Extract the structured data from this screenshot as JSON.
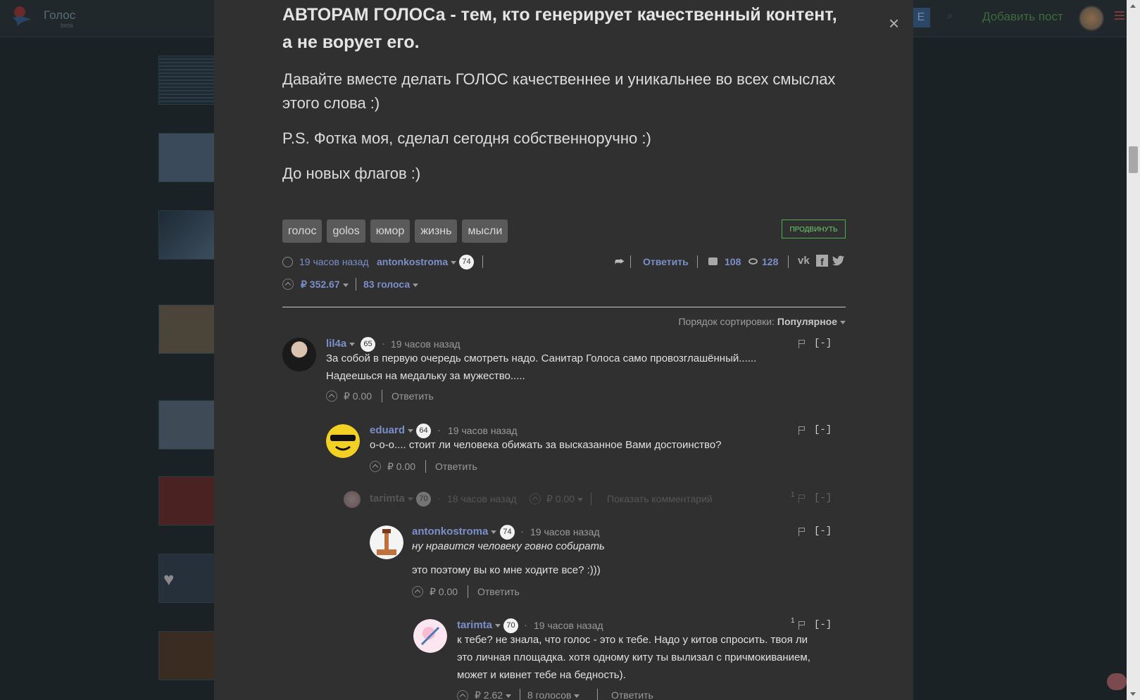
{
  "site": {
    "logo_text": "Голос",
    "logo_sub": "beta",
    "header_button": "E",
    "add_post": "Добавить пост"
  },
  "modal": {
    "close": "×",
    "heading": "АВТОРАМ ГОЛОСа - тем, кто генерирует качественный контент, а не ворует его.",
    "paragraph1": "Давайте вместе делать ГОЛОС качественнее и уникальнее во всех смыслах этого слова :)",
    "paragraph2": "P.S. Фотка моя, сделал сегодня собственноручно :)",
    "paragraph3": "До новых флагов :)",
    "tags": [
      "голос",
      "golos",
      "юмор",
      "жизнь",
      "мысли"
    ],
    "promote_button": "ПРОДВИНУТЬ",
    "meta": {
      "time": "19 часов назад",
      "author": "antonkostroma",
      "reputation": "74",
      "reply": "Ответить",
      "comments_count": "108",
      "views_count": "128",
      "vk": "vk",
      "facebook": "f",
      "payout": "₽ 352.67",
      "votes": "83 голоса"
    },
    "sort": {
      "label": "Порядок сортировки:",
      "value": "Популярное"
    }
  },
  "comments": [
    {
      "author": "lil4a",
      "reputation": "65",
      "time": "19 часов назад",
      "text_lines": [
        "За собой в первую очередь смотреть надо. Санитар Голоса само провозглашённый......",
        "Надеешься на медальку за мужество....."
      ],
      "payout": "₽ 0.00",
      "reply": "Ответить",
      "collapse": "[-]"
    },
    {
      "author": "eduard",
      "reputation": "64",
      "time": "19 часов назад",
      "text": "о-о-о.... стоит ли человека обижать за высказанное Вами достоинство?",
      "payout": "₽ 0.00",
      "reply": "Ответить",
      "collapse": "[-]"
    },
    {
      "author": "tarimta",
      "reputation": "70",
      "time": "18 часов назад",
      "payout": "₽ 0.00",
      "show_comment": "Показать комментарий",
      "flag_count": "1",
      "collapse": "[-]"
    },
    {
      "author": "antonkostroma",
      "reputation": "74",
      "time": "19 часов назад",
      "text_italic": "ну нравится человеку говно собирать",
      "text": "это поэтому вы ко мне ходите все? :)))",
      "payout": "₽ 0.00",
      "reply": "Ответить",
      "collapse": "[-]"
    },
    {
      "author": "tarimta",
      "reputation": "70",
      "time": "19 часов назад",
      "text_lines": [
        "к тебе? не знала, что голос - это к тебе. Надо у китов спросить. твоя ли",
        "это личная площадка. хотя одному киту ты вылизал с причмокиванием,",
        "может и кивнет тебе на бедность)."
      ],
      "payout": "₽ 2.62",
      "votes": "8 голосов",
      "reply": "Ответить",
      "flag_count": "1",
      "collapse": "[-]"
    }
  ]
}
